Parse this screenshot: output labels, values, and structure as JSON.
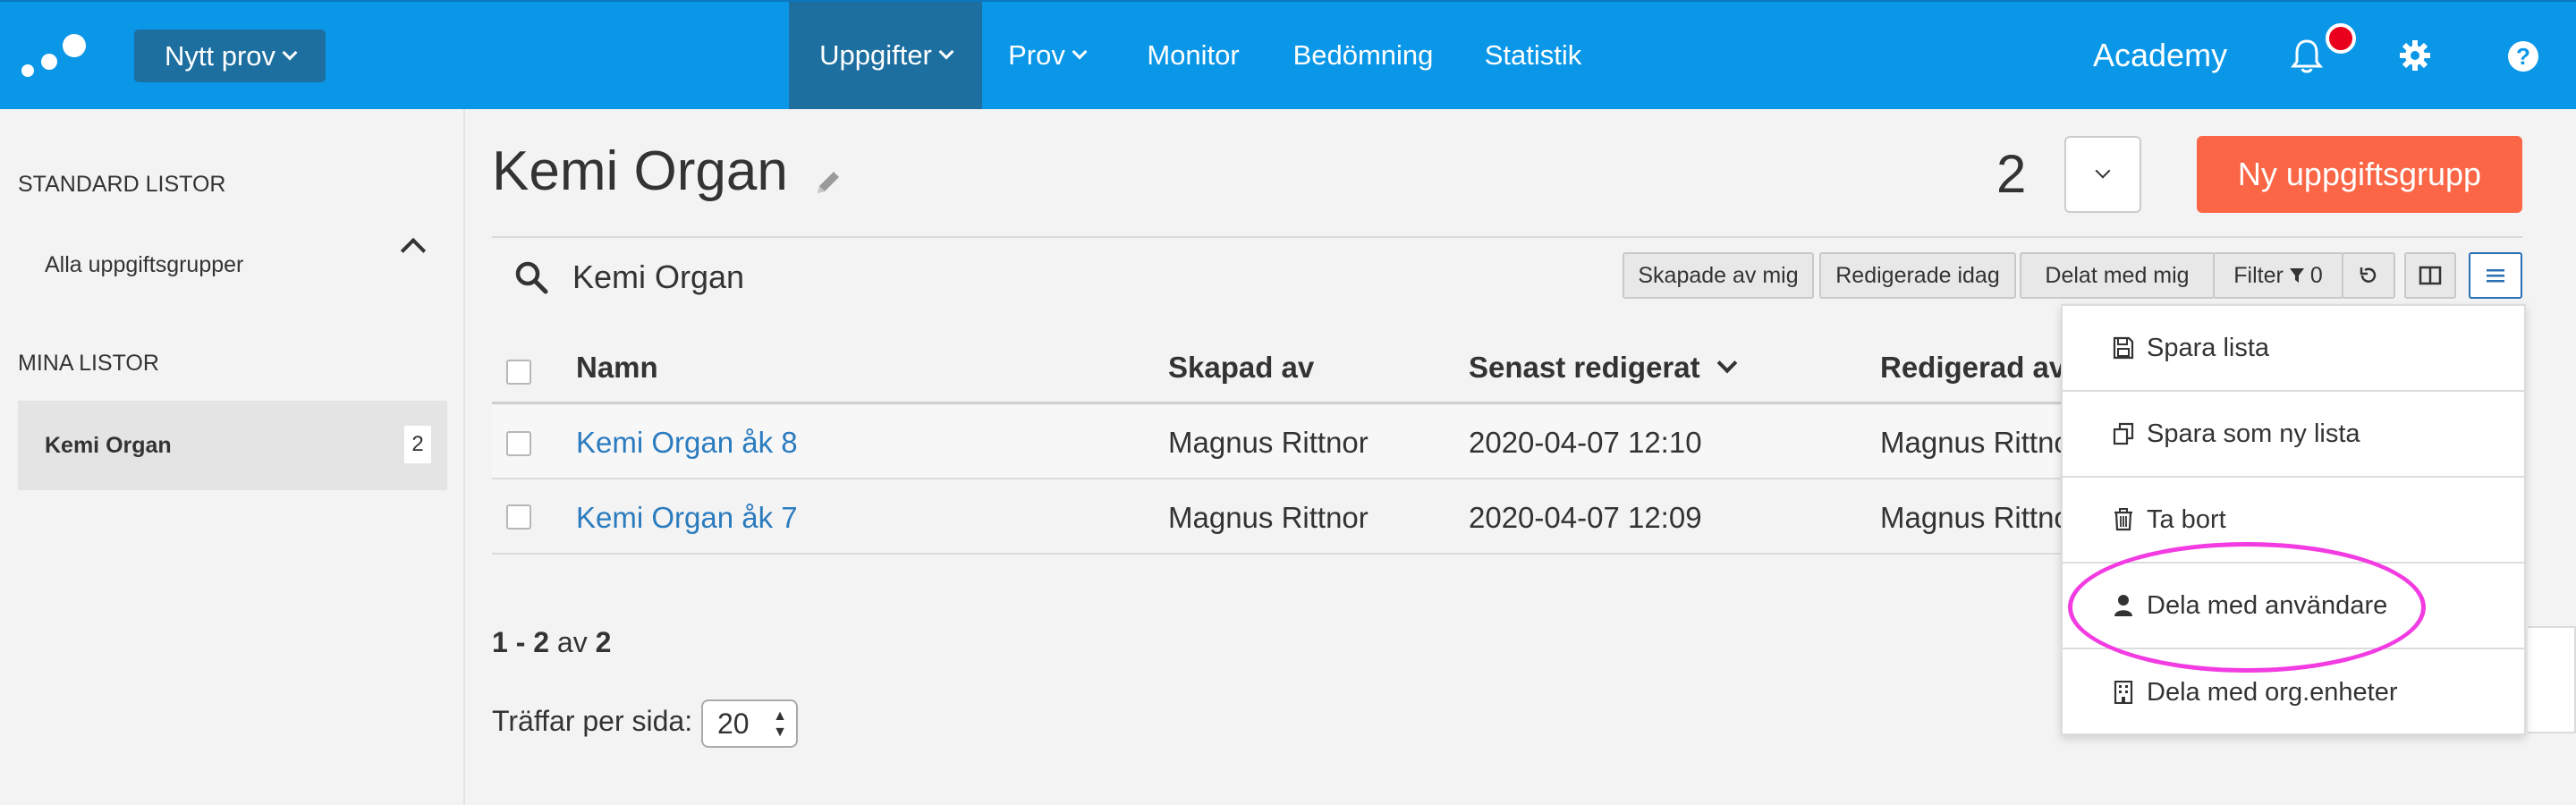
{
  "header": {
    "new_exam_label": "Nytt prov",
    "nav": [
      {
        "label": "Uppgifter",
        "has_menu": true,
        "active": true
      },
      {
        "label": "Prov",
        "has_menu": true,
        "active": false
      },
      {
        "label": "Monitor",
        "has_menu": false,
        "active": false
      },
      {
        "label": "Bedömning",
        "has_menu": false,
        "active": false
      },
      {
        "label": "Statistik",
        "has_menu": false,
        "active": false
      }
    ],
    "academy_label": "Academy",
    "help_glyph": "?",
    "icons": [
      "logo-icon",
      "bell-icon",
      "gear-icon",
      "help-icon"
    ],
    "colors": {
      "bar": "#0a97e8",
      "active": "#1c6f9f",
      "notification": "#e8001c"
    }
  },
  "sidebar": {
    "standard_heading": "STANDARD LISTOR",
    "standard_items": [
      "Alla uppgiftsgrupper"
    ],
    "my_heading": "MINA LISTOR",
    "my_items": [
      {
        "label": "Kemi Organ",
        "count": "2"
      }
    ]
  },
  "main": {
    "title": "Kemi Organ",
    "group_count": "2",
    "new_group_label": "Ny uppgiftsgrupp",
    "search_value": "Kemi Organ",
    "toolbar": {
      "created_by_me": "Skapade av mig",
      "edited_today": "Redigerade idag",
      "shared_with_me": "Delat med mig",
      "filter_label": "Filter",
      "filter_count": "0"
    },
    "columns": [
      "Namn",
      "Skapad av",
      "Senast redigerat",
      "Redigerad av"
    ],
    "rows": [
      {
        "name": "Kemi Organ åk 8",
        "created_by": "Magnus Rittnor",
        "last_edited": "2020-04-07 12:10",
        "edited_by": "Magnus Rittnor"
      },
      {
        "name": "Kemi Organ åk 7",
        "created_by": "Magnus Rittnor",
        "last_edited": "2020-04-07 12:09",
        "edited_by": "Magnus Rittnor"
      }
    ],
    "pager": {
      "range": "1 - 2",
      "of": "av",
      "total": "2"
    },
    "per_page_label": "Träffar per sida:",
    "per_page_value": "20",
    "accent_color": "#fb6646",
    "link_color": "#2b7bbf"
  },
  "menu": {
    "items": [
      {
        "label": "Spara lista",
        "icon": "save-icon"
      },
      {
        "label": "Spara som ny lista",
        "icon": "copy-icon"
      },
      {
        "label": "Ta bort",
        "icon": "trash-icon"
      },
      {
        "label": "Dela med användare",
        "icon": "user-icon"
      },
      {
        "label": "Dela med org.enheter",
        "icon": "building-icon"
      }
    ],
    "highlight_color": "#f23ce2"
  }
}
